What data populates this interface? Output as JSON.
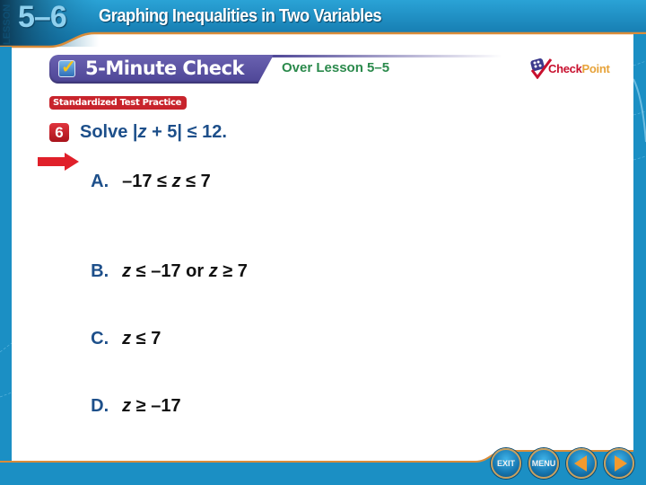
{
  "header": {
    "lesson_label": "LESSON",
    "lesson_number": "5–6",
    "lesson_title": "Graphing Inequalities in Two Variables"
  },
  "section": {
    "title": "5-Minute Check",
    "over_lesson": "Over Lesson 5–5",
    "badge": "Standardized Test Practice",
    "logo": {
      "check": "Check",
      "point": "Point"
    }
  },
  "question": {
    "number": "6",
    "prefix": "Solve |",
    "variable": "z",
    "suffix": " + 5| ≤ 12."
  },
  "answers": [
    {
      "letter": "A.",
      "text": "–17 ≤ z ≤ 7",
      "correct": true
    },
    {
      "letter": "B.",
      "text": "z ≤ –17 or z ≥ 7",
      "correct": false
    },
    {
      "letter": "C.",
      "text": "z ≤ 7",
      "correct": false
    },
    {
      "letter": "D.",
      "text": "z ≥ –17",
      "correct": false
    }
  ],
  "nav": {
    "exit": "EXIT",
    "menu": "MENU",
    "prev_icon": "triangle-left",
    "next_icon": "triangle-right"
  },
  "colors": {
    "banner_blue": "#1b8fc4",
    "accent_orange": "#d98c3a",
    "section_purple": "#4d4596",
    "question_blue": "#1d4f8a",
    "badge_red": "#c8242c",
    "over_lesson_green": "#2b8a4c"
  }
}
